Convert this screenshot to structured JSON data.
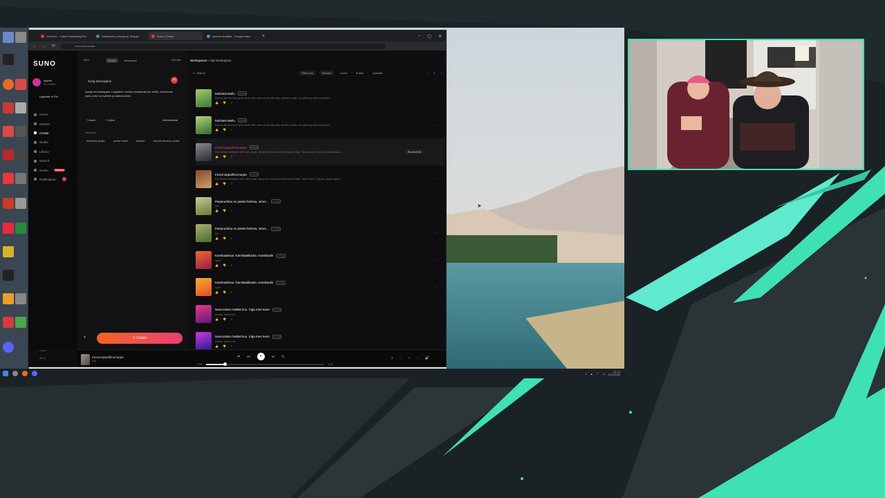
{
  "browser": {
    "tabs": [
      {
        "label": "YouTube – Kalevi Streaming Kot",
        "color": "#e23a3a"
      },
      {
        "label": "Hakulokero (Hemppa) Shoppa",
        "color": "#3a9a5a"
      },
      {
        "label": "Suno | Create",
        "color": "#e23a3a",
        "active": true
      },
      {
        "label": "kaverin musiikki - Google Haku",
        "color": "#4a8ae8"
      }
    ],
    "url": "suno.com/create",
    "nav_back": "←",
    "nav_forward": "→",
    "reload": "⟳",
    "new_tab": "+",
    "window_controls": [
      "–",
      "▢",
      "✕"
    ]
  },
  "suno": {
    "logo": "SUNO",
    "user": {
      "name": "alge68",
      "credits": "50 credits"
    },
    "upgrade_label": "Upgrade to Pro",
    "nav": [
      {
        "label": "Home",
        "icon": "home-icon"
      },
      {
        "label": "Explore",
        "icon": "compass-icon"
      },
      {
        "label": "Create",
        "icon": "pencil-icon",
        "active": true
      },
      {
        "label": "Studio",
        "icon": "studio-icon"
      },
      {
        "label": "Library",
        "icon": "library-icon"
      },
      {
        "label": "Search",
        "icon": "search-icon"
      },
      {
        "label": "Hooks",
        "icon": "hook-icon",
        "badge": "Dreams"
      },
      {
        "label": "Notifications",
        "icon": "bell-icon",
        "dot": true
      }
    ],
    "side_bottom": [
      "Links",
      "More"
    ],
    "create_panel": {
      "version": "v4.5",
      "mode_simple": "Simple",
      "mode_advanced": "Advanced",
      "model": "v4.5-all",
      "song_description_label": "Song Description",
      "description_text": "Iaaaja mmmkaappia. Loppainin vuodan yhiaaleaja (se tehtii), krohkesse nytoi, jolloi ny nylidvin ja laksumainen",
      "audio_label": "+ Audio",
      "lyrics_label": "+ Lyrics",
      "instrumental_label": "Instrumental",
      "inspiration_label": "Inspiration",
      "chips": [
        "electronic guitar",
        "social house",
        "ukraine",
        "smooth dreamy vocals"
      ],
      "create_button": "Create"
    },
    "workspace": {
      "breadcrumb_root": "Workspaces",
      "breadcrumb_current": "My Workspace",
      "search_placeholder": "Search",
      "filters_label": "Filters (3)",
      "sort_label": "Newest",
      "liked_label": "Liked",
      "public_label": "Public",
      "uploads_label": "Uploads",
      "page_prev": "‹",
      "page_number": "1",
      "page_next": "›",
      "songs": [
        {
          "title": "Mobiiest Mullu",
          "version": "v4.5-all",
          "desc": "Bouncy flat kick loop synth driven with male vocals, talk-sing, stacked vocals, and glittering high-end synths...",
          "c1": "#3a7a3a",
          "c2": "#a6c86a"
        },
        {
          "title": "Mobiiest Mullu",
          "version": "v4.5-all",
          "desc": "Bouncy flat kick loop synth driven with male vocals, talk-sing, stacked vocals, and glittering high-end synths...",
          "c1": "#2e6a30",
          "c2": "#b5d47a"
        },
        {
          "title": "Irtosonoppa/kloonoppa",
          "version": "v4.5-all",
          "desc": "Fun fall flat shoestepe with male vocals, stomp fun bass and bubbly synth stabs, 'laaaa' lines, rhythmic, playful dance...",
          "c1": "#2a2a2e",
          "c2": "#8a8a90",
          "hot": true,
          "remix": "Remix/Edit"
        },
        {
          "title": "Irtosonoppa/kloonoppa",
          "version": "v4.5-all",
          "desc": "Fun fall flat shoestepe with male vocals, stomp fun bass and bubbly synth stabs, 'laaaa' lines, rhythmic, playful dance...",
          "c1": "#c9a070",
          "c2": "#8a4a28"
        },
        {
          "title": "Pasanurtiina on paska fortissa, Jenni...",
          "version": "v4.5-all",
          "desc": "folk",
          "c1": "#6a7a3a",
          "c2": "#c8c890"
        },
        {
          "title": "Pasanurtiina on paska fortissa, Jenni...",
          "version": "v4.5-all",
          "desc": "folk",
          "c1": "#4a6a30",
          "c2": "#a8b070"
        },
        {
          "title": "Kamikaalinoa. Kamikaaliluuka. Kamikaalik",
          "version": "v4.5-all",
          "desc": "synth",
          "c1": "#9a1a4a",
          "c2": "#f06a2a"
        },
        {
          "title": "Kamikaalinoa. Kamikaaliluuka. Kamikaalik",
          "version": "v4.5-all",
          "desc": "synth",
          "c1": "#e84a2a",
          "c2": "#f4b030"
        },
        {
          "title": "Nanocotton matkat kuu. Viga mes tuum",
          "version": "v4.5-all",
          "desc": "electric, street rock",
          "c1": "#5a1a7a",
          "c2": "#e83a8a"
        },
        {
          "title": "Nanocotton matkat kuu. Viga mes tuum",
          "version": "v4.5-all",
          "desc": "electric, street rock",
          "c1": "#2a1a9a",
          "c2": "#c83ad8"
        }
      ]
    },
    "player": {
      "title": "Irtosonoppa/kloonoppa",
      "subtitle": "alge",
      "time_current": "0:06",
      "time_total": "3:48",
      "progress": 0.16,
      "shuffle": "⇄",
      "prev": "⏮",
      "play": "⏸",
      "next": "⏭",
      "repeat": "↻",
      "right_icons": [
        "≡",
        "♡",
        "↗",
        "⋯",
        "🔊"
      ]
    }
  },
  "taskbar": {
    "clock_time": "14.14",
    "clock_date": "23.3.2025"
  },
  "colors": {
    "accent_green": "#3fe0b4",
    "suno_pink": "#ea3f72",
    "create_orange": "#f26522"
  }
}
